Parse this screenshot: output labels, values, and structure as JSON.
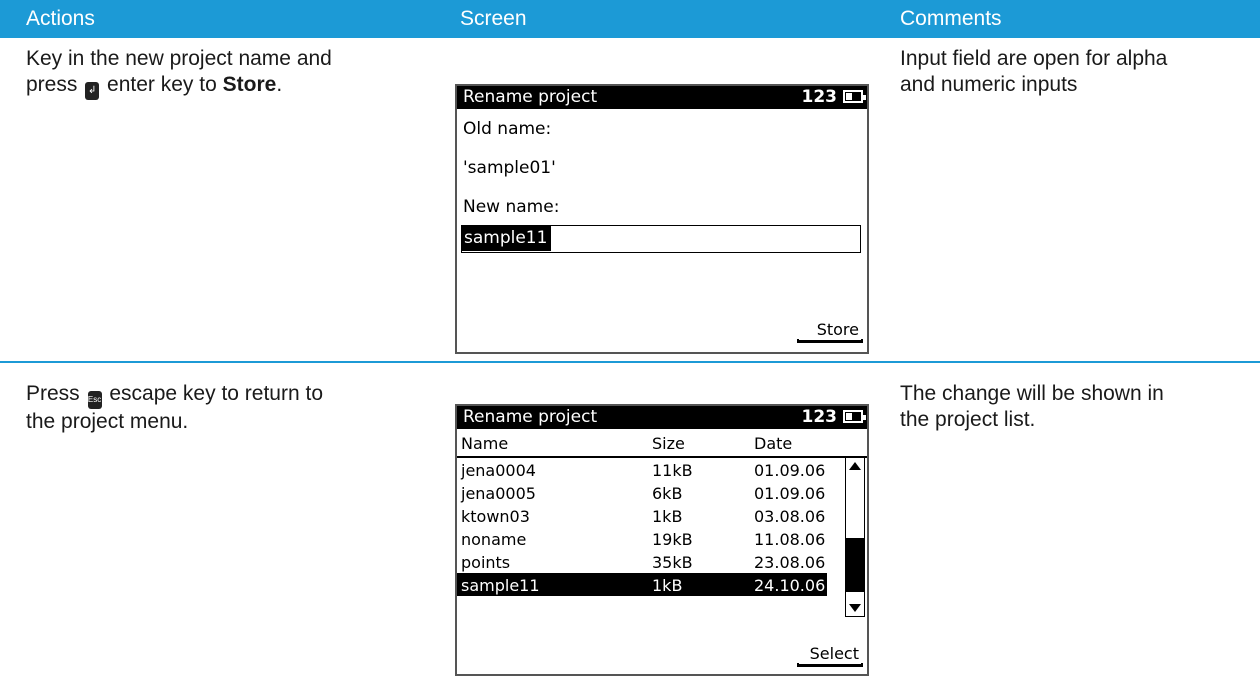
{
  "header": {
    "actions": "Actions",
    "screen": "Screen",
    "comments": "Comments"
  },
  "row1": {
    "action_line1": "Key in the new project name and",
    "action_pre": "press",
    "action_key": "↲",
    "action_mid": "enter key to",
    "action_bold": "Store",
    "action_end": ".",
    "comment_line1": "Input field are open for alpha",
    "comment_line2": "and numeric inputs",
    "screen": {
      "title": "Rename project",
      "mode": "123",
      "old_label": "Old name:",
      "old_value": "'sample01'",
      "new_label": "New name:",
      "input_value": "sample11",
      "softkey": "Store"
    }
  },
  "row2": {
    "action_pre": "Press",
    "action_key": "Esc",
    "action_mid": "escape key to return to",
    "action_line2": "the project menu.",
    "comment_line1": "The change will be shown in",
    "comment_line2": "the project list.",
    "screen": {
      "title": "Rename project",
      "mode": "123",
      "columns": [
        "Name",
        "Size",
        "Date"
      ],
      "rows": [
        {
          "name": "jena0004",
          "size": "11kB",
          "date": "01.09.06"
        },
        {
          "name": "jena0005",
          "size": "6kB",
          "date": "01.09.06"
        },
        {
          "name": "ktown03",
          "size": "1kB",
          "date": "03.08.06"
        },
        {
          "name": "noname",
          "size": "19kB",
          "date": "11.08.06"
        },
        {
          "name": "points",
          "size": "35kB",
          "date": "23.08.06"
        },
        {
          "name": "sample11",
          "size": "1kB",
          "date": "24.10.06"
        }
      ],
      "softkey": "Select"
    }
  }
}
